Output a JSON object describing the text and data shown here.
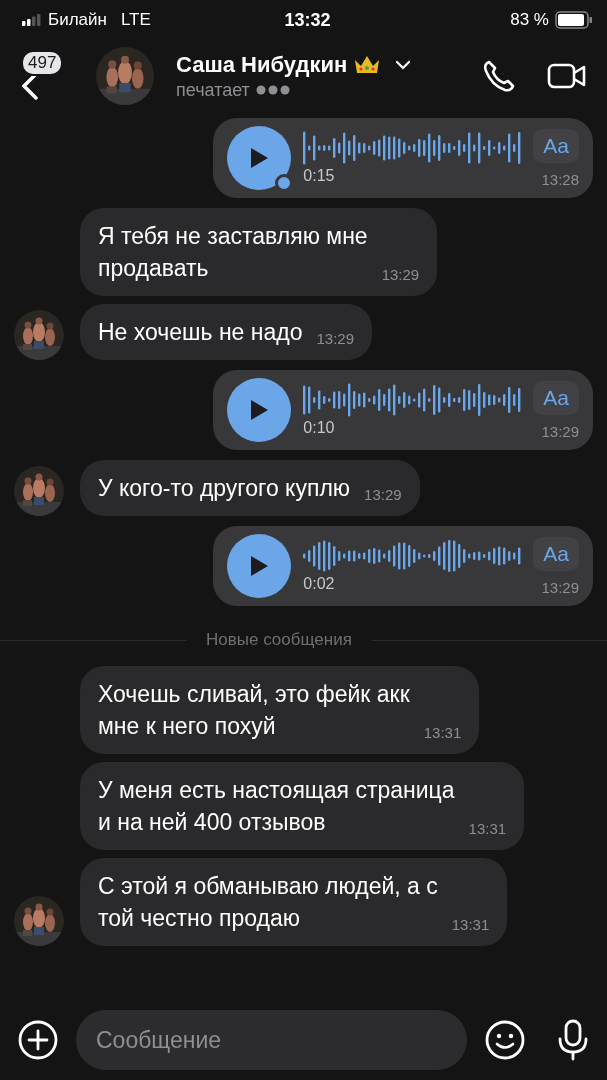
{
  "status_bar": {
    "carrier": "Билайн",
    "network": "LTE",
    "time": "13:32",
    "battery": "83 %"
  },
  "header": {
    "unread_count": "497",
    "name": "Саша Нибудкин",
    "status": "печатает"
  },
  "messages": [
    {
      "kind": "voice",
      "duration": "0:15",
      "time": "13:28",
      "transcribe": "Aa",
      "unplayed": true
    },
    {
      "kind": "text",
      "text": "Я тебя не заставляю мне\nпродавать",
      "time": "13:29",
      "avatar": false
    },
    {
      "kind": "text",
      "text": "Не хочешь не надо",
      "time": "13:29",
      "avatar": true
    },
    {
      "kind": "voice",
      "duration": "0:10",
      "time": "13:29",
      "transcribe": "Aa",
      "unplayed": false
    },
    {
      "kind": "text",
      "text": "У кого-то другого куплю",
      "time": "13:29",
      "avatar": true
    },
    {
      "kind": "voice",
      "duration": "0:02",
      "time": "13:29",
      "transcribe": "Aa",
      "unplayed": false
    },
    {
      "kind": "divider",
      "text": "Новые сообщения"
    },
    {
      "kind": "text",
      "text": "Хочешь сливай, это фейк акк\nмне к него похуй",
      "time": "13:31",
      "avatar": false
    },
    {
      "kind": "text",
      "text": "У меня есть настоящая страница\nи на ней 400 отзывов",
      "time": "13:31",
      "avatar": false
    },
    {
      "kind": "text",
      "text": "С этой я обманываю людей,  а с\nтой честно продаю",
      "time": "13:31",
      "avatar": true
    }
  ],
  "composer": {
    "placeholder": "Сообщение"
  }
}
